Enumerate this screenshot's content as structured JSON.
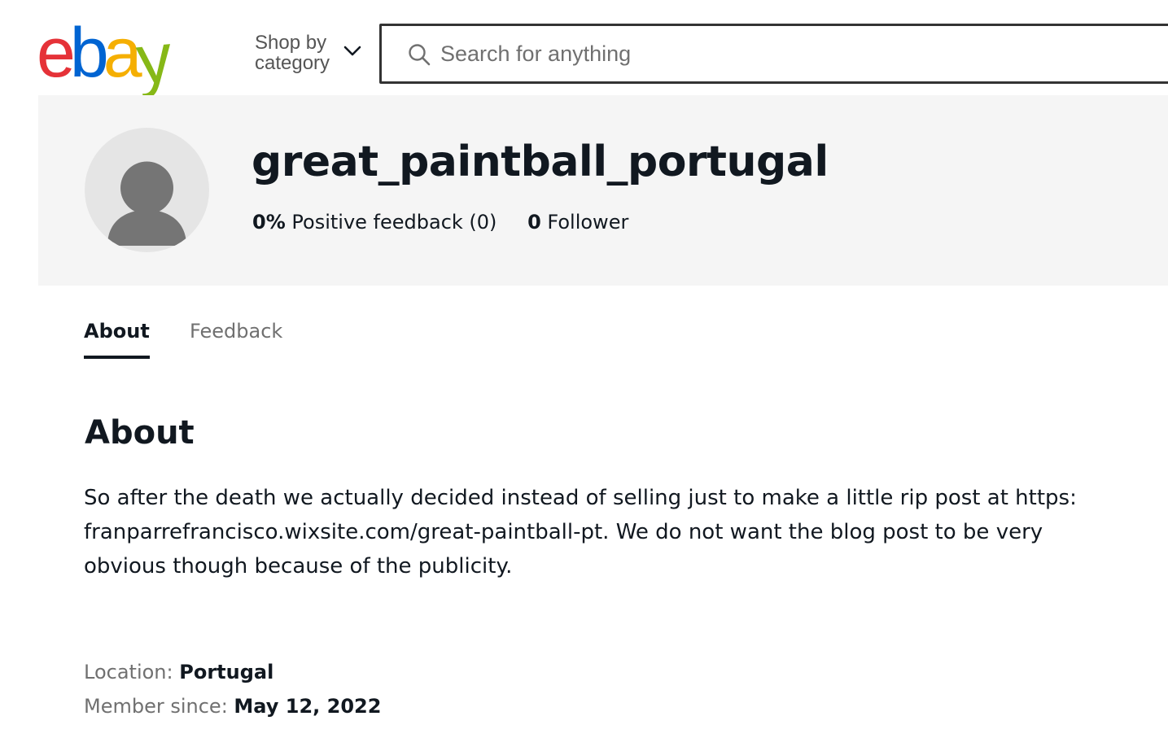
{
  "header": {
    "logo": {
      "e": "e",
      "b": "b",
      "a": "a",
      "y": "y"
    },
    "shop_by_line1": "Shop by",
    "shop_by_line2": "category",
    "search_placeholder": "Search for anything",
    "search_value": ""
  },
  "colors": {
    "logo_e": "#e53238",
    "logo_b": "#0064d2",
    "logo_a": "#f5af02",
    "logo_y": "#86b817",
    "banner_bg": "#f5f5f5",
    "text_primary": "#111820",
    "text_secondary": "#707070"
  },
  "profile": {
    "username": "great_paintball_portugal",
    "feedback_percent": "0%",
    "feedback_label": "Positive feedback (0)",
    "followers_count": "0",
    "followers_label": "Follower"
  },
  "tabs": [
    {
      "label": "About",
      "active": true
    },
    {
      "label": "Feedback",
      "active": false
    }
  ],
  "about": {
    "heading": "About",
    "text": "So after the death we actually decided instead of selling just to make a little rip post at https: franparrefrancisco.wixsite.com/great-paintball-pt. We do not want the blog post to be very obvious though because of the publicity.",
    "location_label": "Location:",
    "location_value": "Portugal",
    "member_since_label": "Member since:",
    "member_since_value": "May 12, 2022"
  },
  "icons": {
    "search": "search-icon",
    "chevron": "chevron-down-icon",
    "avatar": "user-avatar-icon"
  }
}
